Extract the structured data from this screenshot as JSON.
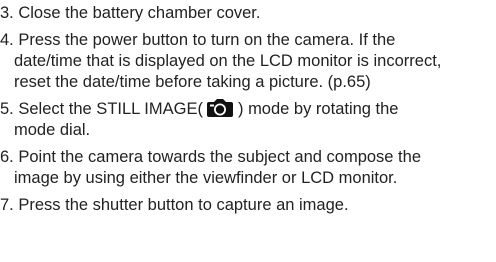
{
  "cut_text": "",
  "steps": [
    {
      "lines": [
        "3. Close the battery chamber cover."
      ]
    },
    {
      "lines": [
        "4. Press the power button to turn on the camera. If the",
        "date/time that is displayed on the LCD monitor is incorrect,",
        "reset the date/time before taking a picture. (p.65)"
      ]
    },
    {
      "lines": [
        "5. Select the STILL IMAGE(",
        ") mode by rotating the",
        "mode dial."
      ],
      "icon": "camera-icon"
    },
    {
      "lines": [
        "6. Point the camera towards the subject and compose the",
        "image by using either the viewfinder or LCD monitor."
      ]
    },
    {
      "lines": [
        "7. Press the shutter button to capture an image."
      ]
    }
  ]
}
